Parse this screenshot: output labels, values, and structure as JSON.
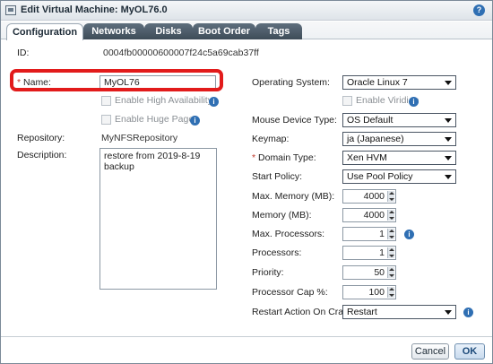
{
  "window": {
    "title": "Edit Virtual Machine: MyOL76.0",
    "help_glyph": "?"
  },
  "tabs": [
    {
      "label": "Configuration",
      "active": true
    },
    {
      "label": "Networks",
      "active": false
    },
    {
      "label": "Disks",
      "active": false
    },
    {
      "label": "Boot Order",
      "active": false
    },
    {
      "label": "Tags",
      "active": false
    }
  ],
  "left": {
    "id_label": "ID:",
    "id_value": "0004fb00000600007f24c5a69cab37ff",
    "name_required_mark": "*",
    "name_label": "Name:",
    "name_value": "MyOL76",
    "high_availability_label": "Enable High Availability",
    "huge_pages_label": "Enable Huge Pages",
    "repository_label": "Repository:",
    "repository_value": "MyNFSRepository",
    "description_label": "Description:",
    "description_value": "restore from 2019-8-19 backup"
  },
  "right": {
    "os_label": "Operating System:",
    "os_value": "Oracle Linux 7",
    "viridian_label": "Enable Viridian",
    "mouse_label": "Mouse Device Type:",
    "mouse_value": "OS Default",
    "keymap_label": "Keymap:",
    "keymap_value": "ja (Japanese)",
    "domain_required_mark": "*",
    "domain_label": "Domain Type:",
    "domain_value": "Xen HVM",
    "start_policy_label": "Start Policy:",
    "start_policy_value": "Use Pool Policy",
    "max_memory_label": "Max. Memory (MB):",
    "max_memory_value": "4000",
    "memory_label": "Memory (MB):",
    "memory_value": "4000",
    "max_processors_label": "Max. Processors:",
    "max_processors_value": "1",
    "processors_label": "Processors:",
    "processors_value": "1",
    "priority_label": "Priority:",
    "priority_value": "50",
    "cap_label": "Processor Cap %:",
    "cap_value": "100",
    "restart_label": "Restart Action On Crash:",
    "restart_value": "Restart"
  },
  "footer": {
    "cancel_label": "Cancel",
    "ok_label": "OK"
  },
  "icons": {
    "info_glyph": "i"
  },
  "colors": {
    "highlight": "#e21b1b",
    "tab_dark": "#3e4c58",
    "info": "#2f6fb3"
  }
}
